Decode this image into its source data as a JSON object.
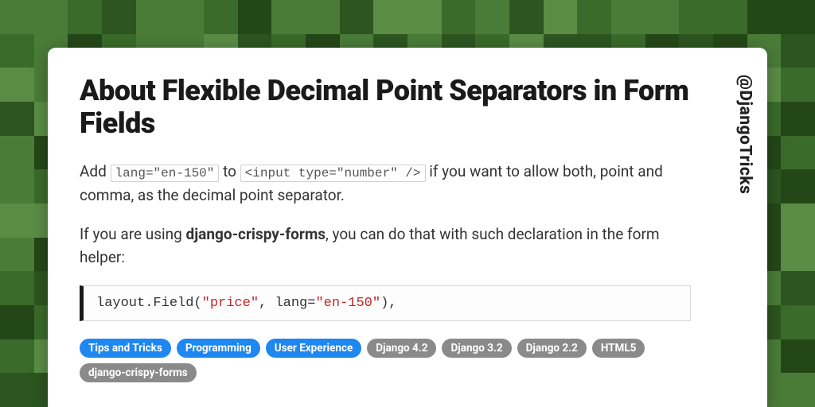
{
  "handle": "@DjangoTricks",
  "title": "About Flexible Decimal Point Separators in Form Fields",
  "para1": {
    "pre": "Add ",
    "code1": "lang=\"en-150\"",
    "mid": " to ",
    "code2": "<input type=\"number\" />",
    "post": " if you want to allow both, point and comma, as the decimal point separator."
  },
  "para2": {
    "pre": "If you are using ",
    "bold": "django-crispy-forms",
    "post": ", you can do that with such declaration in the form helper:"
  },
  "code_block": {
    "p1": "layout.Field(",
    "s1": "\"price\"",
    "p2": ", lang=",
    "s2": "\"en-150\"",
    "p3": "),"
  },
  "tags": [
    {
      "label": "Tips and Tricks",
      "kind": "blue"
    },
    {
      "label": "Programming",
      "kind": "blue"
    },
    {
      "label": "User Experience",
      "kind": "blue"
    },
    {
      "label": "Django 4.2",
      "kind": "gray"
    },
    {
      "label": "Django 3.2",
      "kind": "gray"
    },
    {
      "label": "Django 2.2",
      "kind": "gray"
    },
    {
      "label": "HTML5",
      "kind": "gray"
    },
    {
      "label": "django-crispy-forms",
      "kind": "gray"
    }
  ]
}
